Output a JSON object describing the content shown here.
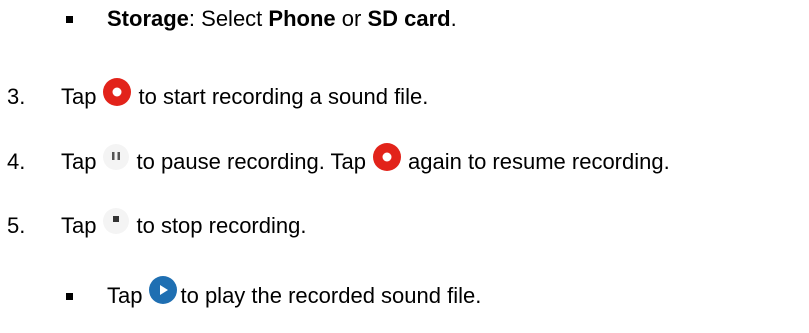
{
  "storage_line": {
    "label": "Storage",
    "text1": ": Select ",
    "option1": "Phone",
    "text2": " or ",
    "option2": "SD card",
    "text3": "."
  },
  "steps": [
    {
      "number": "3.",
      "text1": "Tap",
      "icon": "record-icon",
      "text2": "to start recording a sound file."
    },
    {
      "number": "4.",
      "text1": "Tap",
      "icon": "pause-icon",
      "text2": "to pause recording. Tap",
      "icon2": "record-icon",
      "text3": "again to resume recording."
    },
    {
      "number": "5.",
      "text1": "Tap",
      "icon": "stop-icon",
      "text2": "to stop recording."
    }
  ],
  "sub_bullet": {
    "text1": "Tap",
    "icon": "play-icon",
    "text2": "to play the recorded sound file."
  },
  "colors": {
    "record": "#e2231a",
    "play": "#1f6fb2",
    "neutral_icon": "#f2f2f2"
  }
}
